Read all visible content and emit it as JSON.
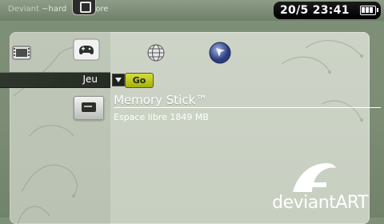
{
  "theme": {
    "prefix": "Deviant",
    "suffix": "~hard",
    "suffix2": "ore"
  },
  "status": {
    "clock": "20/5 23:41"
  },
  "categories": [
    {
      "name": "video-icon"
    },
    {
      "name": "game-icon"
    },
    {
      "name": "network-icon"
    },
    {
      "name": "psn-icon"
    }
  ],
  "category_selector": {
    "label": "Jeu",
    "go_label": "Go"
  },
  "memory_stick": {
    "title": "Memory Stick™",
    "free_space": "Espace libre  1849 MB"
  },
  "logo": {
    "text": "deviantART"
  },
  "colors": {
    "accent": "#c0cc20",
    "panel": "#cbd2c5",
    "background": "#7c8c75"
  }
}
